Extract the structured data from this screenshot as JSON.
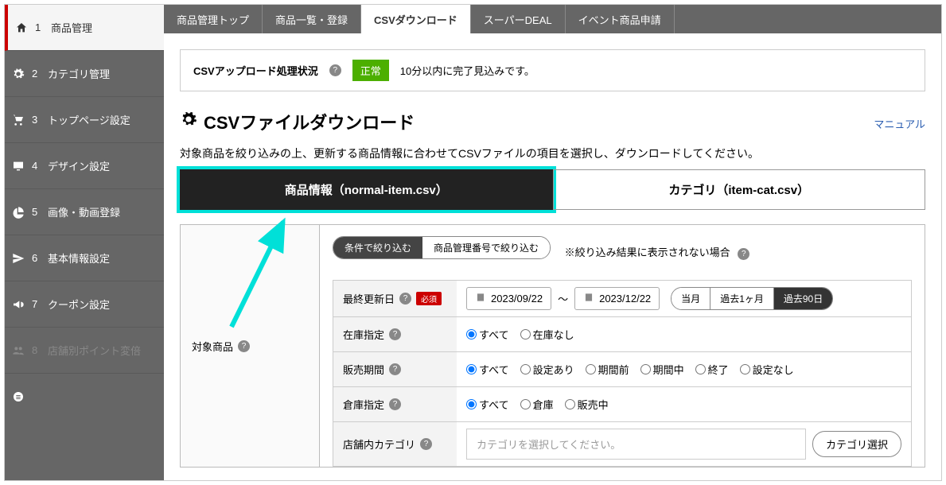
{
  "sidebar": {
    "items": [
      {
        "num": "1",
        "label": "商品管理",
        "icon": "home"
      },
      {
        "num": "2",
        "label": "カテゴリ管理",
        "icon": "gear"
      },
      {
        "num": "3",
        "label": "トップページ設定",
        "icon": "cart"
      },
      {
        "num": "4",
        "label": "デザイン設定",
        "icon": "monitor"
      },
      {
        "num": "5",
        "label": "画像・動画登録",
        "icon": "pie"
      },
      {
        "num": "6",
        "label": "基本情報設定",
        "icon": "send"
      },
      {
        "num": "7",
        "label": "クーポン設定",
        "icon": "megaphone"
      },
      {
        "num": "8",
        "label": "店舗別ポイント変倍",
        "icon": "users"
      }
    ]
  },
  "tabs": [
    "商品管理トップ",
    "商品一覧・登録",
    "CSVダウンロード",
    "スーパーDEAL",
    "イベント商品申請"
  ],
  "activeTab": "CSVダウンロード",
  "status": {
    "label": "CSVアップロード処理状況",
    "badge": "正常",
    "text": "10分以内に完了見込みです。"
  },
  "page": {
    "title": "CSVファイルダウンロード",
    "manual": "マニュアル",
    "desc": "対象商品を絞り込みの上、更新する商品情報に合わせてCSVファイルの項目を選択し、ダウンロードしてください。"
  },
  "bigTabs": [
    "商品情報（normal-item.csv）",
    "カテゴリ（item-cat.csv）"
  ],
  "filter": {
    "leftLabel": "対象商品",
    "toggle": [
      "条件で絞り込む",
      "商品管理番号で絞り込む"
    ],
    "note": "※絞り込み結果に表示されない場合",
    "rows": {
      "lastUpdate": {
        "label": "最終更新日",
        "required": "必須",
        "from": "2023/09/22",
        "sep": "〜",
        "to": "2023/12/22",
        "ranges": [
          "当月",
          "過去1ヶ月",
          "過去90日"
        ],
        "activeRange": 2
      },
      "stock": {
        "label": "在庫指定",
        "options": [
          "すべて",
          "在庫なし"
        ],
        "selected": 0
      },
      "period": {
        "label": "販売期間",
        "options": [
          "すべて",
          "設定あり",
          "期間前",
          "期間中",
          "終了",
          "設定なし"
        ],
        "selected": 0
      },
      "warehouse": {
        "label": "倉庫指定",
        "options": [
          "すべて",
          "倉庫",
          "販売中"
        ],
        "selected": 0
      },
      "category": {
        "label": "店舗内カテゴリ",
        "placeholder": "カテゴリを選択してください。",
        "button": "カテゴリ選択"
      }
    }
  }
}
